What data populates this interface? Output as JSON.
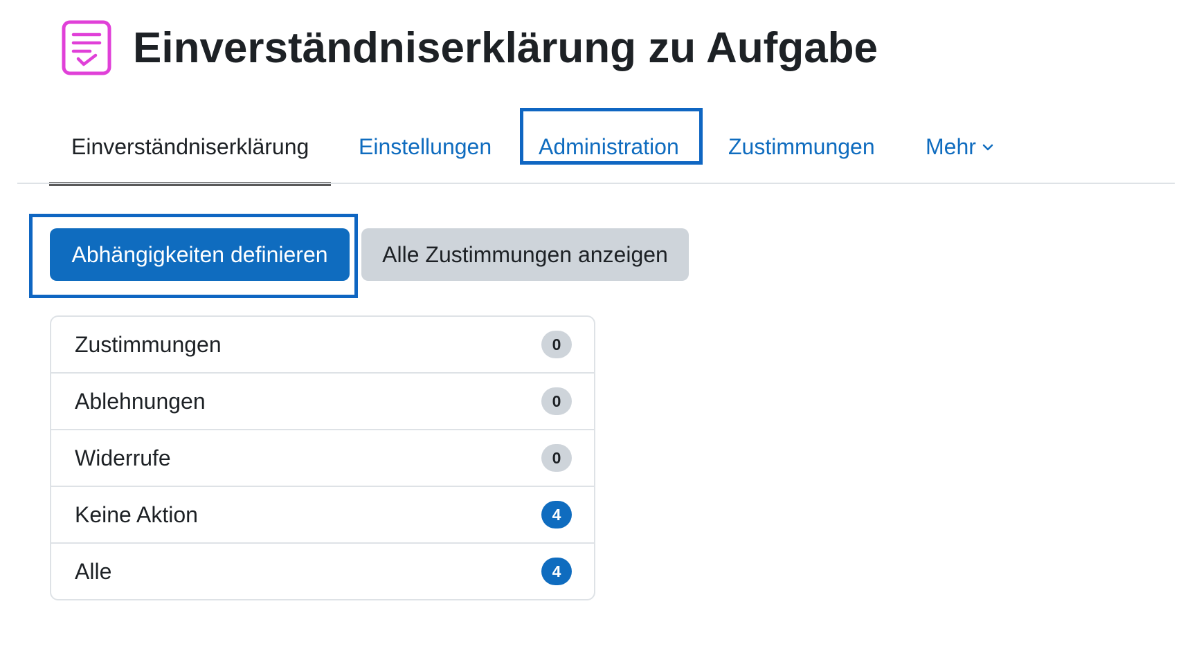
{
  "header": {
    "title": "Einverständniserklärung zu Aufgabe",
    "icon": "checklist-document-icon",
    "icon_color": "#e040d8"
  },
  "nav": {
    "tabs": [
      {
        "label": "Einverständniserklärung",
        "active": true
      },
      {
        "label": "Einstellungen",
        "active": false
      },
      {
        "label": "Administration",
        "active": false,
        "highlighted": true
      },
      {
        "label": "Zustimmungen",
        "active": false
      },
      {
        "label": "Mehr",
        "active": false,
        "dropdown": true
      }
    ]
  },
  "actions": {
    "primary_label": "Abhängigkeiten definieren",
    "secondary_label": "Alle Zustimmungen anzeigen"
  },
  "stats": {
    "items": [
      {
        "label": "Zustimmungen",
        "count": "0",
        "badge": "grey"
      },
      {
        "label": "Ablehnungen",
        "count": "0",
        "badge": "grey"
      },
      {
        "label": "Widerrufe",
        "count": "0",
        "badge": "grey"
      },
      {
        "label": "Keine Aktion",
        "count": "4",
        "badge": "blue"
      },
      {
        "label": "Alle",
        "count": "4",
        "badge": "blue"
      }
    ]
  },
  "colors": {
    "accent": "#0f6cbf",
    "highlight_border": "#0f66c2",
    "badge_grey": "#ced4da"
  }
}
